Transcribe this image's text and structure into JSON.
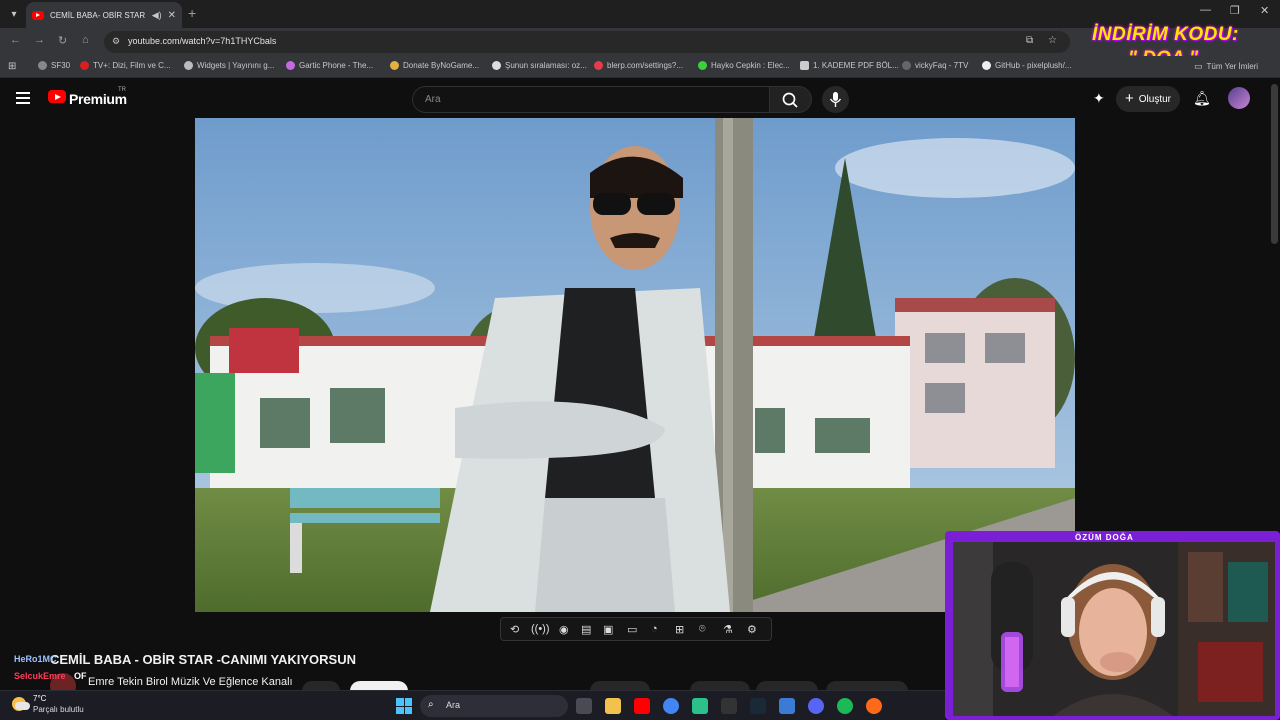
{
  "browser": {
    "tab_title": "CEMİL BABA- OBİR STAR -C",
    "url": "youtube.com/watch?v=7h1THYCbals",
    "bookmarks": [
      "SF30",
      "TV+: Dizi, Film ve C...",
      "Widgets | Yayınını g...",
      "Gartic Phone - The...",
      "Donate ByNoGame...",
      "Şunun sıralaması: oz...",
      "blerp.com/settings?...",
      "Hayko Cepkin : Elec...",
      "1. KADEME PDF BÖL...",
      "vickyFaq - 7TV",
      "GitHub - pixelplush/..."
    ],
    "all_bookmarks": "Tüm Yer İmleri"
  },
  "promo": {
    "line1": "İNDİRİM KODU:",
    "line2": "\" DOA \""
  },
  "youtube": {
    "brand": "Premium",
    "country": "TR",
    "search_placeholder": "Ara",
    "create_label": "Oluştur"
  },
  "video": {
    "title": "CEMİL BABA - OBİR STAR -CANIMI YAKIYORSUN",
    "channel": "Emre Tekin Birol Müzik Ve Eğlence Kanalı"
  },
  "chat": {
    "user1": "HeRo1MC",
    "user2": "SelcukEmre",
    "message2": "OF"
  },
  "webcam": {
    "label": "ÖZÜM DOĞA"
  },
  "taskbar": {
    "temperature": "7°C",
    "weather": "Parçalı bulutlu",
    "search_placeholder": "Ara"
  },
  "colors": {
    "accent_purple": "#7b1fd6",
    "youtube_red": "#ff0000",
    "promo_yellow": "#ffe600"
  }
}
